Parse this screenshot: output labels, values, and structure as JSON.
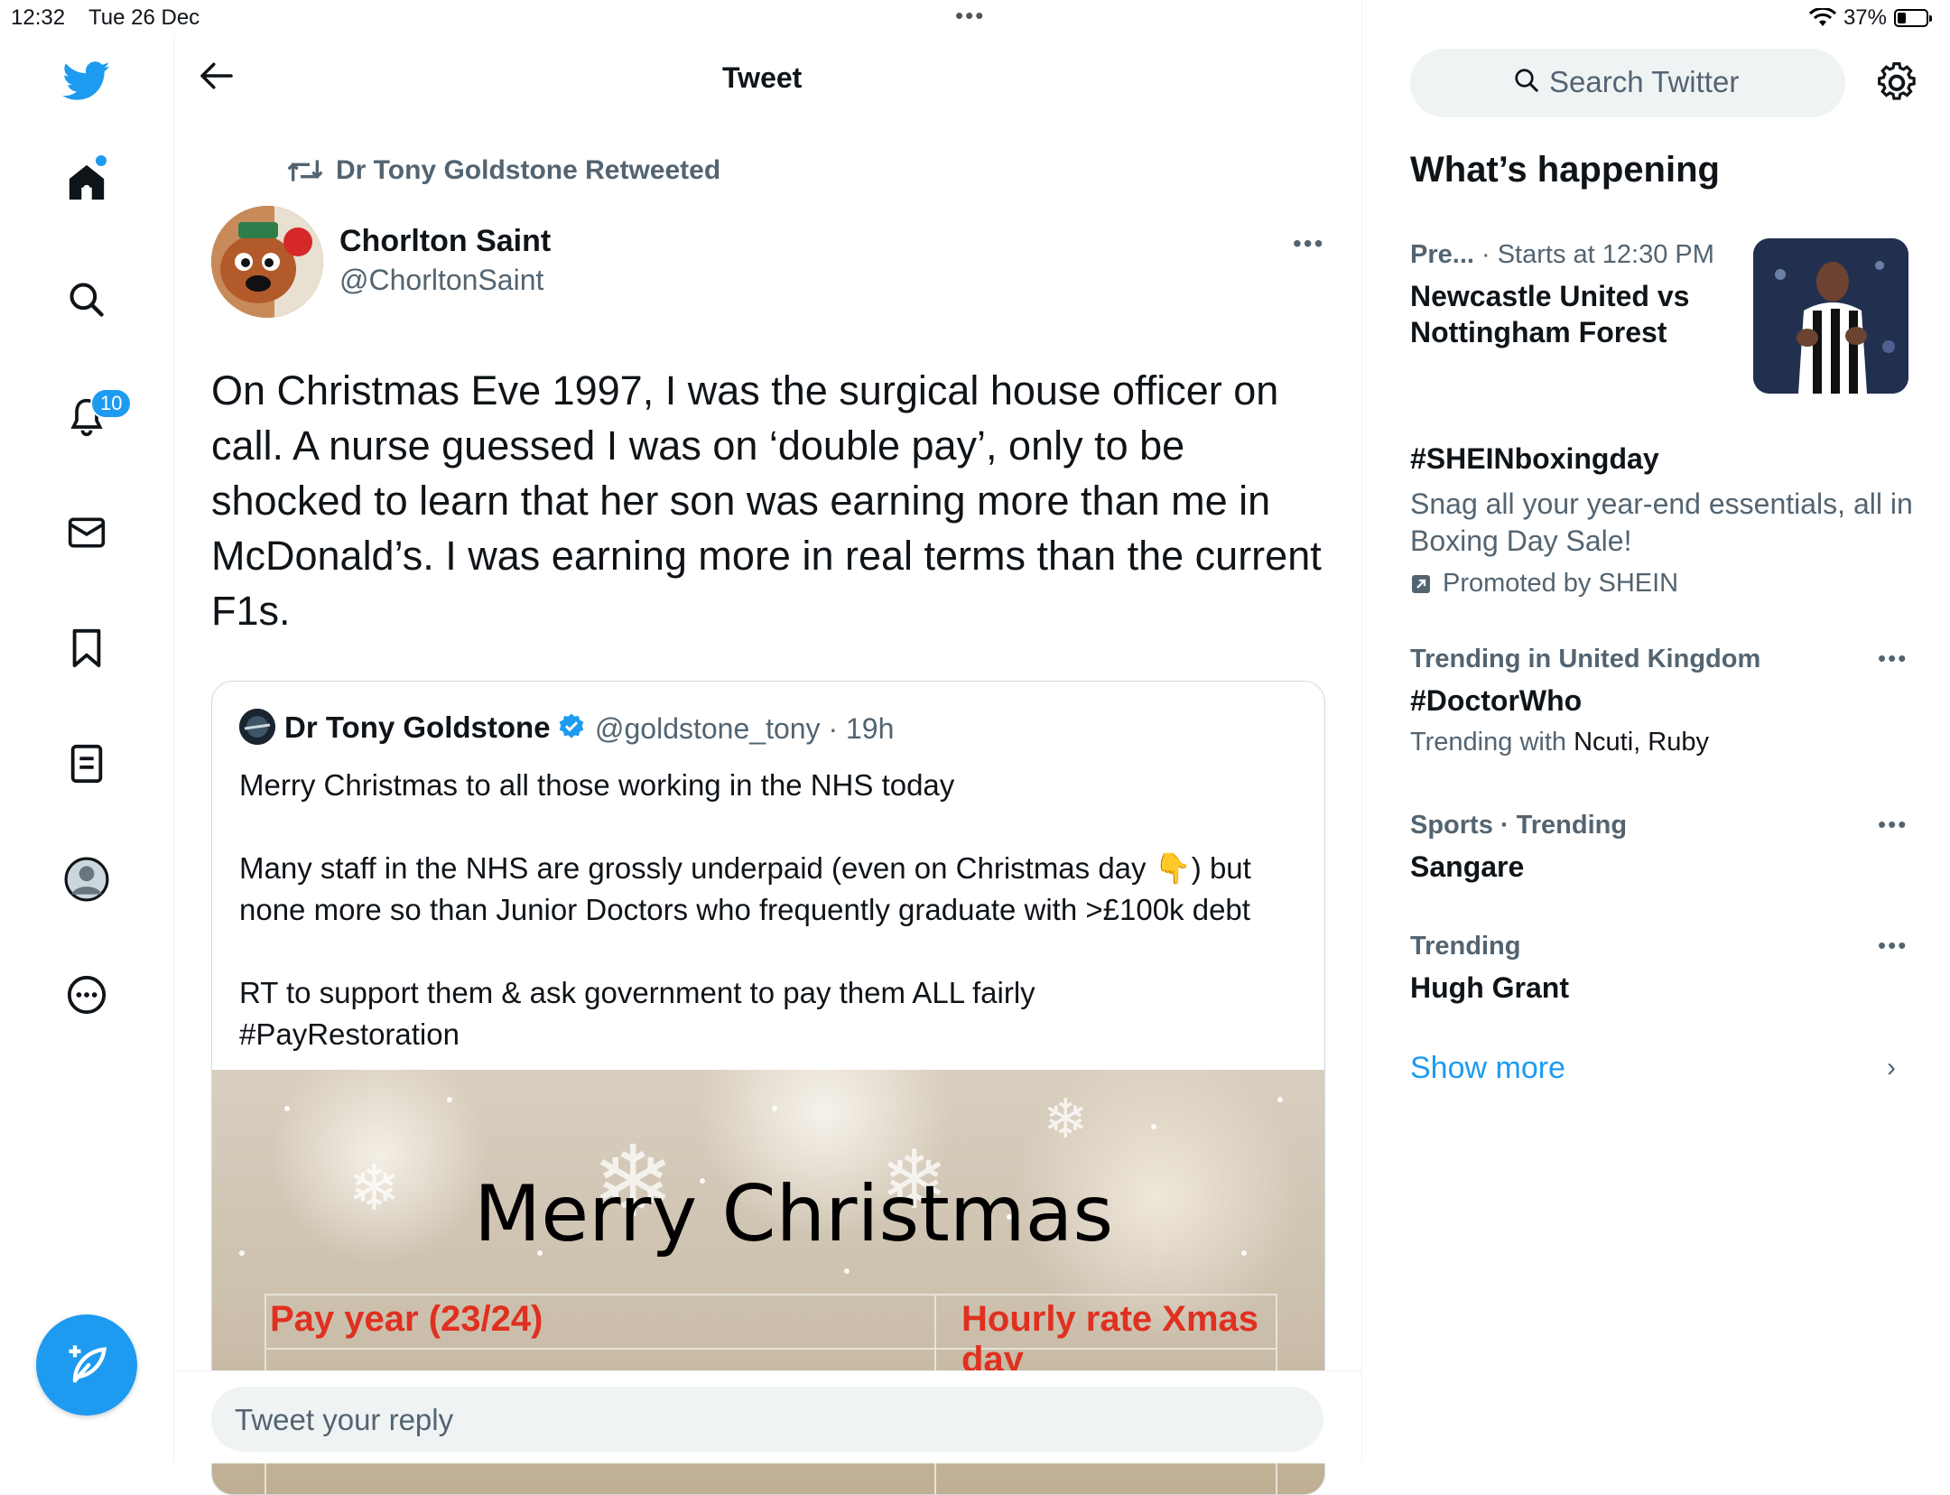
{
  "status_bar": {
    "time": "12:32",
    "date": "Tue 26 Dec",
    "battery": "37%"
  },
  "nav": {
    "notifications_count": "10",
    "items": [
      "home-icon",
      "search-icon",
      "bell-icon",
      "mail-icon",
      "bookmark-icon",
      "lists-icon",
      "profile-icon",
      "more-icon"
    ],
    "compose_label": "compose-tweet-icon"
  },
  "header": {
    "title": "Tweet"
  },
  "tweet": {
    "retweeted_by": "Dr Tony Goldstone Retweeted",
    "author_name": "Chorlton Saint",
    "author_handle": "@ChorltonSaint",
    "text": "On Christmas Eve 1997, I was the surgical house officer on call. A nurse guessed I was on ‘double pay’, only to be shocked to learn that her son was earning more than me in McDonald’s.  I was earning more in real terms than the current F1s."
  },
  "quote": {
    "name": "Dr Tony Goldstone",
    "handle_time": "@goldstone_tony · 19h",
    "line1": "Merry Christmas to all those working in the NHS today",
    "line2": "Many staff in the NHS are grossly underpaid (even on Christmas day 👇) but none more so than Junior Doctors who frequently graduate with >£100k debt",
    "line3": "RT to support them & ask government to pay them ALL fairly",
    "line4": "#PayRestoration",
    "image": {
      "heading": "Merry Christmas",
      "col1": "Pay year (23/24)",
      "col2": "Hourly rate Xmas day"
    }
  },
  "reply": {
    "placeholder": "Tweet your reply"
  },
  "sidebar": {
    "search_placeholder": "Search Twitter",
    "section_title": "What’s happening",
    "event": {
      "category": "Pre...",
      "meta": " · Starts at 12:30 PM",
      "title_line1": "Newcastle United vs",
      "title_line2": "Nottingham Forest"
    },
    "promo": {
      "tag": "#SHEINboxingday",
      "desc": "Snag all your year-end essentials, all in Boxing Day Sale!",
      "promoted": "Promoted by SHEIN"
    },
    "trends": [
      {
        "context": "Trending in United Kingdom",
        "name": "#DoctorWho",
        "with_prefix": "Trending with ",
        "with": "Ncuti, Ruby"
      },
      {
        "context": "Sports · Trending",
        "name": "Sangare"
      },
      {
        "context": "Trending",
        "name": "Hugh Grant"
      }
    ],
    "show_more": "Show more"
  },
  "colors": {
    "accent": "#1d9bf0",
    "text": "#0f1419",
    "secondary": "#536471"
  }
}
